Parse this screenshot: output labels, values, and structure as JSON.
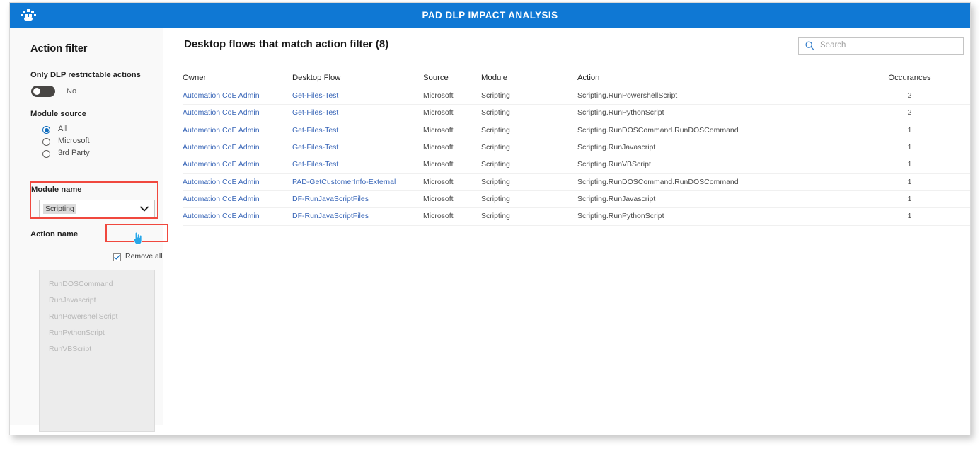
{
  "header": {
    "title": "PAD DLP IMPACT ANALYSIS",
    "logo_icon": "paw-scatter-icon"
  },
  "sidebar": {
    "heading": "Action filter",
    "dlp_filter": {
      "label": "Only DLP restrictable actions",
      "toggle_value": "No",
      "toggle_state": "off"
    },
    "module_source": {
      "label": "Module source",
      "options": [
        {
          "label": "All",
          "selected": true
        },
        {
          "label": "Microsoft",
          "selected": false
        },
        {
          "label": "3rd Party",
          "selected": false
        }
      ]
    },
    "module_name": {
      "label": "Module name",
      "selected_value": "Scripting",
      "chevron_icon": "chevron-down-icon"
    },
    "action_name": {
      "label": "Action name",
      "remove_all_label": "Remove all",
      "remove_all_checked": true,
      "items": [
        "RunDOSCommand",
        "RunJavascript",
        "RunPowershellScript",
        "RunPythonScript",
        "RunVBScript"
      ]
    }
  },
  "main": {
    "title": "Desktop flows that match action filter (8)",
    "search": {
      "placeholder": "Search",
      "value": "",
      "icon": "search-icon"
    },
    "table": {
      "columns": [
        "Owner",
        "Desktop Flow",
        "Source",
        "Module",
        "Action",
        "Occurances"
      ],
      "rows": [
        {
          "owner": "Automation CoE Admin",
          "flow": "Get-Files-Test",
          "source": "Microsoft",
          "module": "Scripting",
          "action": "Scripting.RunPowershellScript",
          "occurances": "2"
        },
        {
          "owner": "Automation CoE Admin",
          "flow": "Get-Files-Test",
          "source": "Microsoft",
          "module": "Scripting",
          "action": "Scripting.RunPythonScript",
          "occurances": "2"
        },
        {
          "owner": "Automation CoE Admin",
          "flow": "Get-Files-Test",
          "source": "Microsoft",
          "module": "Scripting",
          "action": "Scripting.RunDOSCommand.RunDOSCommand",
          "occurances": "1"
        },
        {
          "owner": "Automation CoE Admin",
          "flow": "Get-Files-Test",
          "source": "Microsoft",
          "module": "Scripting",
          "action": "Scripting.RunJavascript",
          "occurances": "1"
        },
        {
          "owner": "Automation CoE Admin",
          "flow": "Get-Files-Test",
          "source": "Microsoft",
          "module": "Scripting",
          "action": "Scripting.RunVBScript",
          "occurances": "1"
        },
        {
          "owner": "Automation CoE Admin",
          "flow": "PAD-GetCustomerInfo-External",
          "source": "Microsoft",
          "module": "Scripting",
          "action": "Scripting.RunDOSCommand.RunDOSCommand",
          "occurances": "1"
        },
        {
          "owner": "Automation CoE Admin",
          "flow": "DF-RunJavaScriptFiles",
          "source": "Microsoft",
          "module": "Scripting",
          "action": "Scripting.RunJavascript",
          "occurances": "1"
        },
        {
          "owner": "Automation CoE Admin",
          "flow": "DF-RunJavaScriptFiles",
          "source": "Microsoft",
          "module": "Scripting",
          "action": "Scripting.RunPythonScript",
          "occurances": "1"
        }
      ]
    }
  },
  "annotations": {
    "highlight_color": "#f0483e",
    "boxes": [
      "module-name-block",
      "remove-all-checkbox"
    ],
    "cursor": "hand-pointer-cursor"
  },
  "colors": {
    "header_blue": "#0f78d4",
    "link_blue": "#3a67b8",
    "accent_blue": "#0f6cbd",
    "sidebar_bg": "#f9f9f9"
  }
}
